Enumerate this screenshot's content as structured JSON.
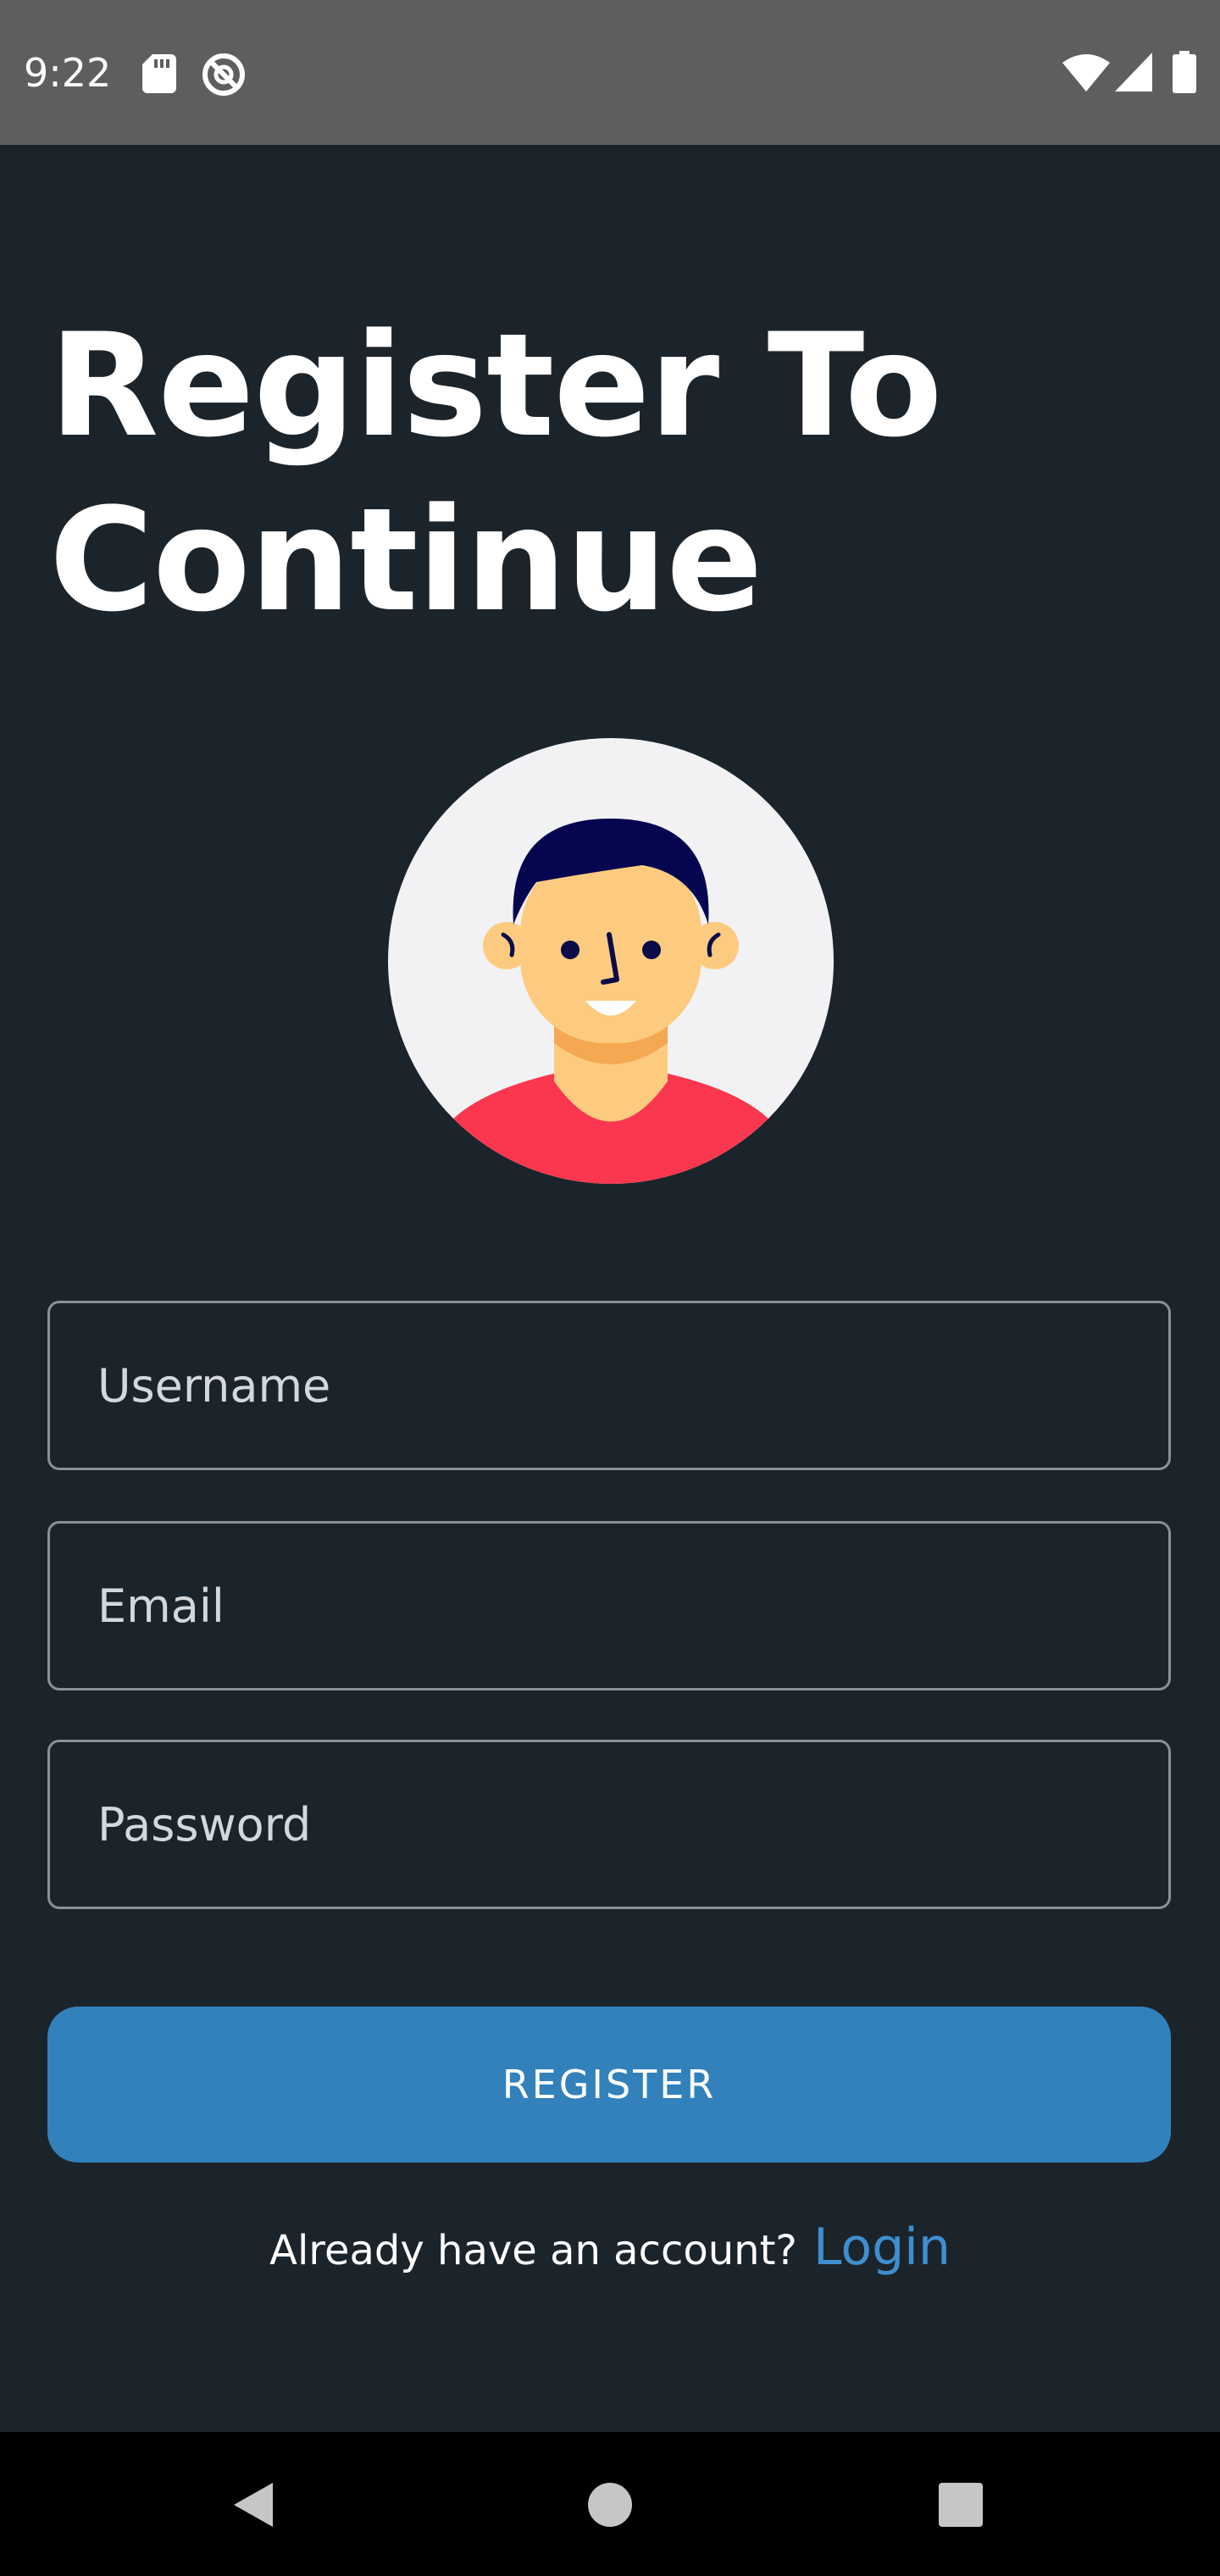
{
  "status_bar": {
    "time": "9:22",
    "icons": [
      "sd-card-icon",
      "do-not-disturb-icon",
      "wifi-icon",
      "cell-signal-icon",
      "battery-icon"
    ]
  },
  "title": {
    "line1": "Register To",
    "line2": "Continue"
  },
  "form": {
    "username_placeholder": "Username",
    "email_placeholder": "Email",
    "password_placeholder": "Password"
  },
  "register_button": "REGISTER",
  "login": {
    "prompt": "Already have an account?",
    "link": "Login"
  },
  "colors": {
    "background": "#1c242b",
    "accent": "#3281bb",
    "link": "#3f8fd0",
    "status_bar": "#5e5e5e"
  },
  "nav_bar": {
    "icons": [
      "back-icon",
      "home-icon",
      "recents-icon"
    ]
  }
}
